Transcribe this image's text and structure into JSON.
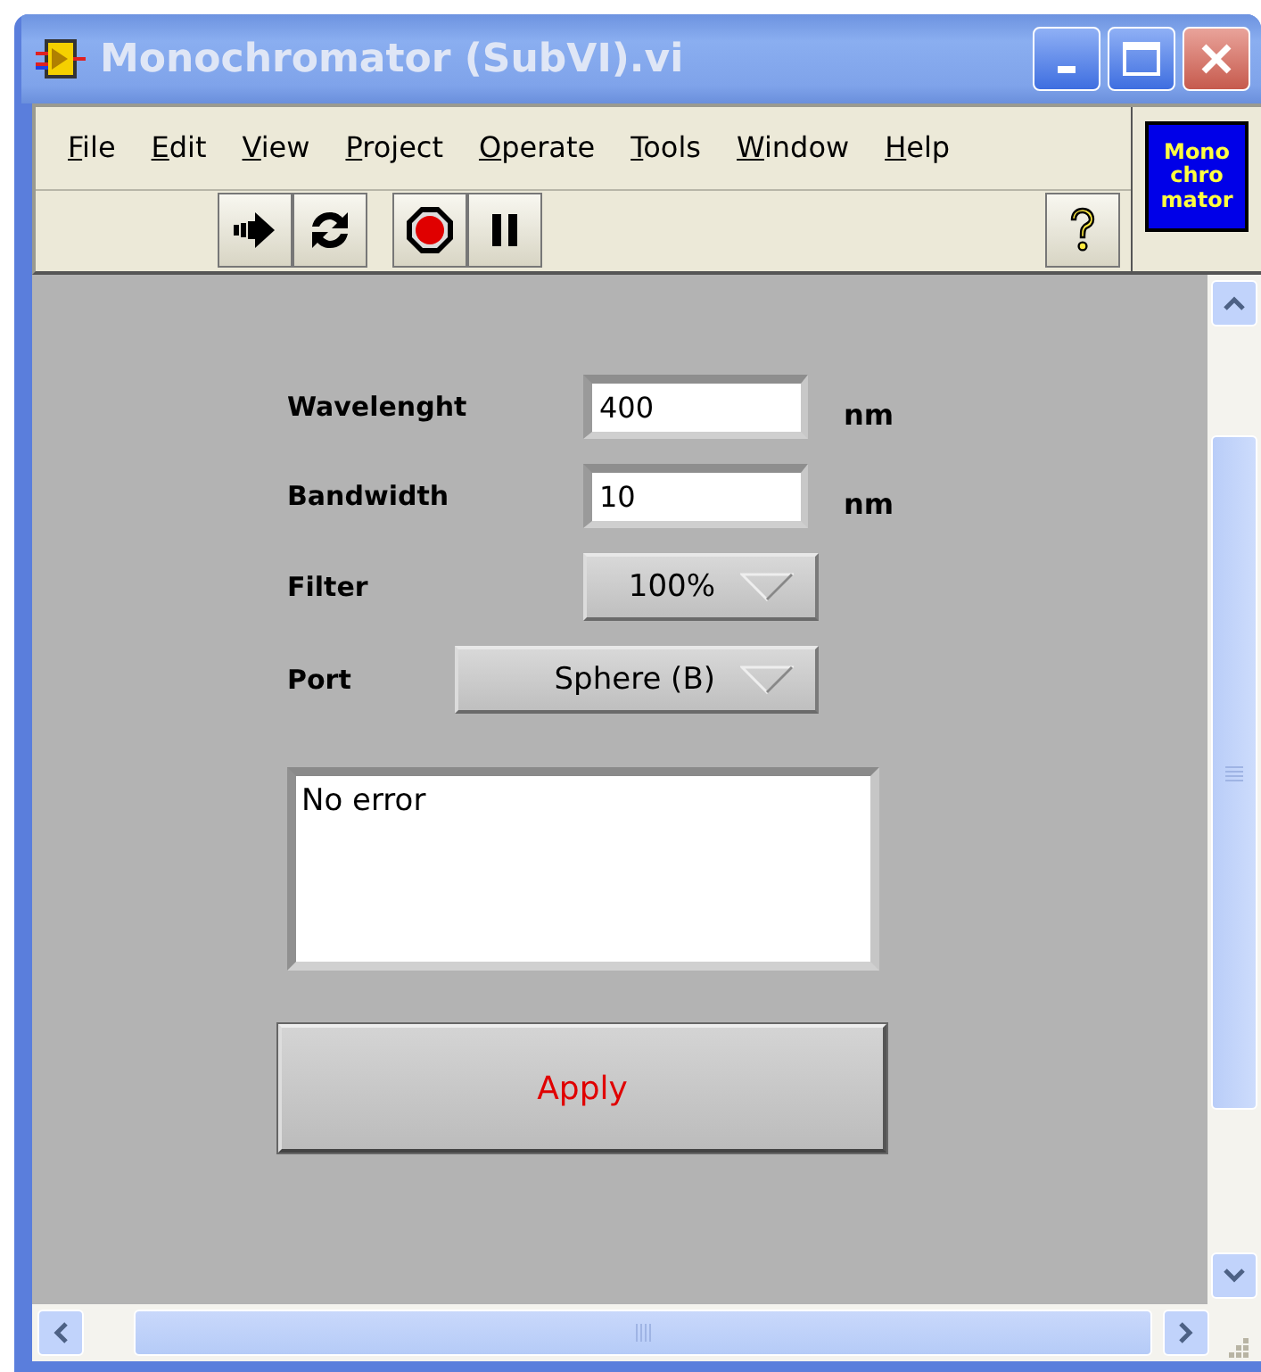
{
  "window": {
    "title": "Monochromator (SubVI).vi"
  },
  "menu": [
    {
      "label": "File"
    },
    {
      "label": "Edit"
    },
    {
      "label": "View"
    },
    {
      "label": "Project"
    },
    {
      "label": "Operate"
    },
    {
      "label": "Tools"
    },
    {
      "label": "Window"
    },
    {
      "label": "Help"
    }
  ],
  "toolbar": {
    "buttons": [
      {
        "kind": "run"
      },
      {
        "kind": "run-continuous"
      },
      {
        "kind": "abort"
      },
      {
        "kind": "pause"
      }
    ],
    "help_button": {
      "kind": "help"
    }
  },
  "vi_icon": {
    "lines": [
      "Mono",
      "chro",
      "mator"
    ]
  },
  "controls": [
    {
      "kind": "numeric",
      "label": "Wavelenght",
      "value": "400",
      "unit": "nm"
    },
    {
      "kind": "numeric",
      "label": "Bandwidth",
      "value": "10",
      "unit": "nm"
    },
    {
      "kind": "ring",
      "label": "Filter",
      "value": "100%"
    },
    {
      "kind": "ring",
      "label": "Port",
      "value": "Sphere (B)"
    }
  ],
  "error_box": {
    "text": "No error"
  },
  "apply_button": {
    "label": "Apply"
  }
}
